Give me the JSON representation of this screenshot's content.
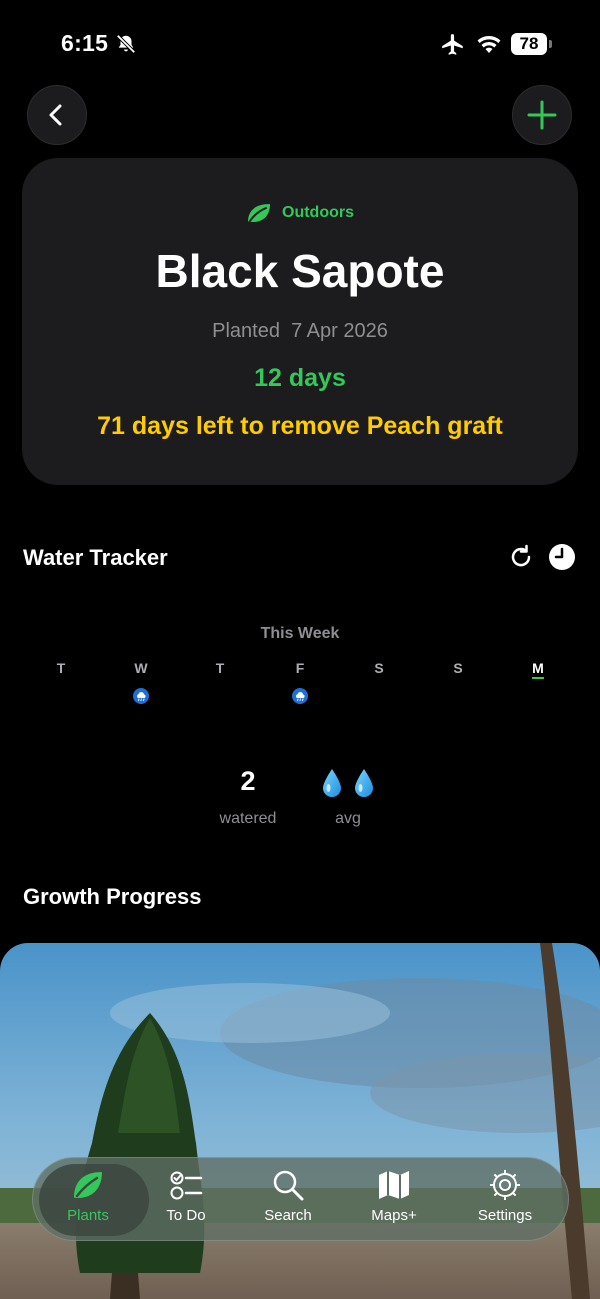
{
  "status_bar": {
    "time": "6:15",
    "battery": "78"
  },
  "header": {
    "back_icon": "chevron-left-icon",
    "add_icon": "plus-icon",
    "accent_color": "#34c759"
  },
  "plant": {
    "location": "Outdoors",
    "name": "Black Sapote",
    "planted_label": "Planted",
    "planted_date": "7 Apr 2026",
    "age": "12 days",
    "graft_notice": "71 days left to remove Peach graft",
    "graft_color": "#ffcc00"
  },
  "water_tracker": {
    "title": "Water Tracker",
    "week_label": "This Week",
    "days": [
      {
        "letter": "T",
        "watered": false,
        "today": false
      },
      {
        "letter": "W",
        "watered": true,
        "today": false
      },
      {
        "letter": "T",
        "watered": false,
        "today": false
      },
      {
        "letter": "F",
        "watered": true,
        "today": false
      },
      {
        "letter": "S",
        "watered": false,
        "today": false
      },
      {
        "letter": "S",
        "watered": false,
        "today": false
      },
      {
        "letter": "M",
        "watered": false,
        "today": true
      }
    ],
    "watered_count": "2",
    "watered_label": "watered",
    "avg_label": "avg",
    "avg_drops": 2
  },
  "growth": {
    "title": "Growth Progress"
  },
  "tab_bar": {
    "tabs": [
      {
        "label": "Plants",
        "icon": "leaf-icon",
        "active": true
      },
      {
        "label": "To Do",
        "icon": "checklist-icon",
        "active": false
      },
      {
        "label": "Search",
        "icon": "search-icon",
        "active": false
      },
      {
        "label": "Maps+",
        "icon": "map-icon",
        "active": false
      },
      {
        "label": "Settings",
        "icon": "gear-icon",
        "active": false
      }
    ]
  }
}
